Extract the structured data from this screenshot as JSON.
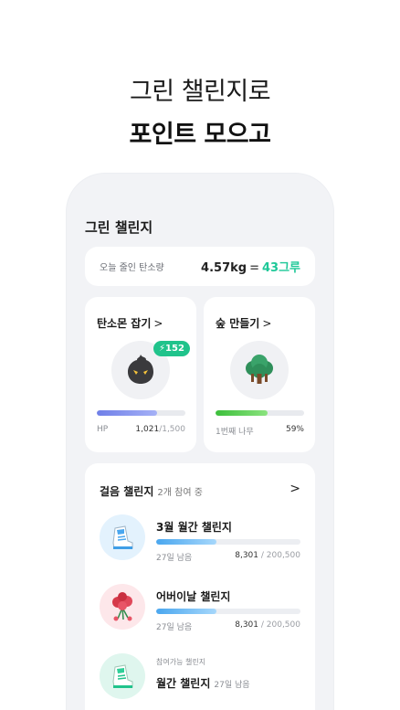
{
  "headline": {
    "line1": "그린 챌린지로",
    "line2": "포인트 모으고"
  },
  "app": {
    "title": "그린 챌린지"
  },
  "carbon": {
    "label": "오늘 줄인 탄소량",
    "value": "4.57kg",
    "equals": "=",
    "trees": "43그루"
  },
  "cards": {
    "monster": {
      "title": "탄소몬 잡기",
      "chevron": ">",
      "badge": "152",
      "hp_label": "HP",
      "hp_current": "1,021",
      "hp_max": "/1,500",
      "hp_fraction": 0.68
    },
    "forest": {
      "title": "숲 만들기",
      "chevron": ">",
      "tree_label": "1번째 나무",
      "percent_label": "59%",
      "fraction": 0.59
    }
  },
  "walking": {
    "title": "걸음 챌린지",
    "subtitle": "2개 참여 중",
    "chevron": ">",
    "items": [
      {
        "name": "3월 월간 챌린지",
        "days": "27일 남음",
        "current": "8,301",
        "total": "/ 200,500",
        "fraction": 0.42
      },
      {
        "name": "어버이날 챌린지",
        "days": "27일 남음",
        "current": "8,301",
        "total": "/ 200,500",
        "fraction": 0.42
      }
    ],
    "available": {
      "label": "참여가능 챌린지",
      "name": "월간 챌린지",
      "days": "27일 남음"
    }
  },
  "colors": {
    "accent_green": "#1ec898",
    "badge_green": "#20c38b",
    "hp_blue": "#6f7fe8",
    "tree_green": "#3cbf3b",
    "walk_blue": "#4aa7ef"
  },
  "icons": [
    "bolt-icon",
    "carbon-monster-icon",
    "tree-icon",
    "sneaker-icon",
    "carnation-icon",
    "chevron-right-icon"
  ]
}
